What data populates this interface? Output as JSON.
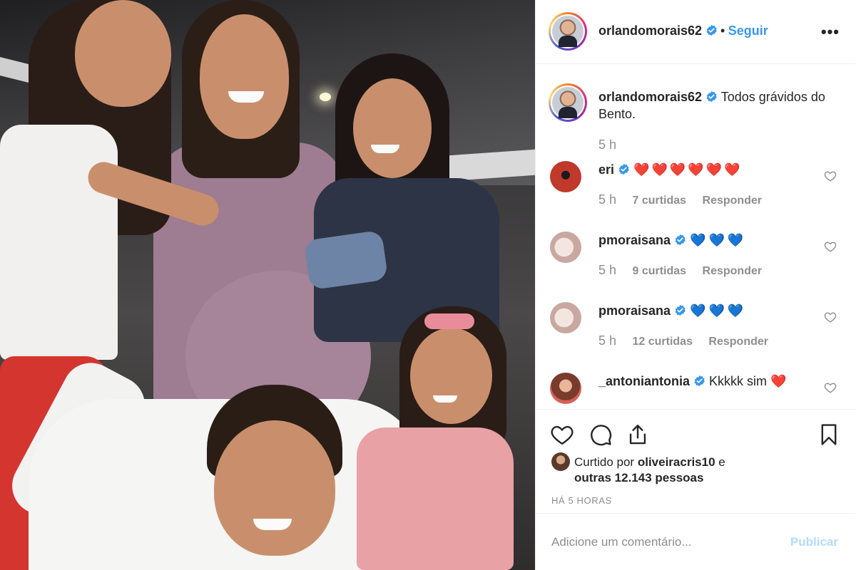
{
  "post": {
    "author": "orlandomorais62",
    "follow_label": "Seguir",
    "separator": "•",
    "more_label": "•••",
    "caption_text": "Todos grávidos do Bento.",
    "caption_time": "5 h"
  },
  "comments": [
    {
      "user": "eri",
      "text": "❤️❤️❤️❤️❤️❤️",
      "time": "5 h",
      "likes": "7 curtidas",
      "reply": "Responder"
    },
    {
      "user": "pmoraisana",
      "text": "💙💙💙",
      "time": "5 h",
      "likes": "9 curtidas",
      "reply": "Responder"
    },
    {
      "user": "pmoraisana",
      "text": "💙💙💙",
      "time": "5 h",
      "likes": "12 curtidas",
      "reply": "Responder"
    },
    {
      "user": "_antoniantonia",
      "text": "Kkkkk sim ❤️"
    }
  ],
  "actions": {
    "liked_by_prefix": "Curtido por",
    "liked_by_user": "oliveiracris10",
    "liked_by_and": "e",
    "liked_by_others": "outras 12.143 pessoas",
    "posted_ago": "HÁ 5 HORAS"
  },
  "comment_box": {
    "placeholder": "Adicione um comentário...",
    "publish_label": "Publicar"
  },
  "icons": {
    "verified": "verified-badge-icon",
    "like": "heart-icon",
    "comment": "comment-bubble-icon",
    "share": "share-upload-icon",
    "save": "bookmark-icon",
    "comment_like": "small-heart-icon"
  },
  "colors": {
    "link_blue": "#3897f0",
    "verified_blue": "#3897f0",
    "muted_text": "#8e8e8e",
    "publish_disabled": "#b3dbff"
  }
}
